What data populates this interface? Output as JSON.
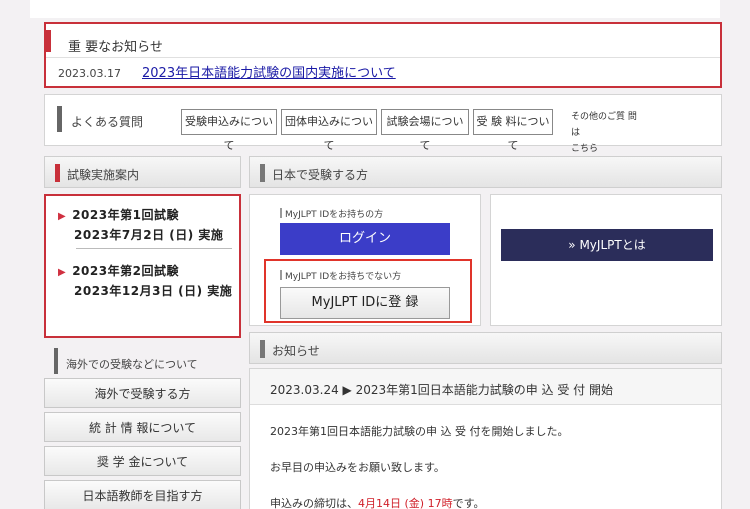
{
  "notice": {
    "title": "重 要なお知らせ",
    "date": "2023.03.17",
    "link": "2023年日本語能力試験の国内実施について"
  },
  "faq": {
    "title": "よくある質問",
    "buttons": [
      "受験申込みについて",
      "団体申込みについて",
      "試験会場について",
      "受 験 料について"
    ],
    "other_line1": "その他のご質 問は",
    "other_line2": "こちら"
  },
  "schedule": {
    "header": "試験実施案内",
    "items": [
      {
        "line1": "2023年第1回試験",
        "line2": "2023年7月2日 (日) 実施"
      },
      {
        "line1": "2023年第2回試験",
        "line2": "2023年12月3日 (日) 実施"
      }
    ]
  },
  "domestic": {
    "header": "日本で受験する方",
    "with_id_label": "MyJLPT IDをお持ちの方",
    "login": "ログイン",
    "without_id_label": "MyJLPT IDをお持ちでない方",
    "register": "MyJLPT IDに登 録",
    "about": "» MyJLPTとは"
  },
  "overseas": {
    "header": "海外での受験などについて",
    "buttons": [
      "海外で受験する方",
      "統 計 情 報について",
      "奨 学 金について",
      "日本語教師を目指す方"
    ]
  },
  "news": {
    "header": "お知らせ",
    "item": "2023.03.24 ▶ 2023年第1回日本語能力試験の申 込 受 付 開始",
    "p1": "2023年第1回日本語能力試験の申 込 受 付を開始しました。",
    "p2": "お早目の申込みをお願い致します。",
    "p3_prefix": "申込みの締切は、",
    "p3_deadline": "4月14日 (金) 17時",
    "p3_suffix": "です。"
  },
  "colors": {
    "accent_red": "#c8303a",
    "login_blue": "#3b3dc8",
    "about_navy": "#2b2d5a"
  }
}
